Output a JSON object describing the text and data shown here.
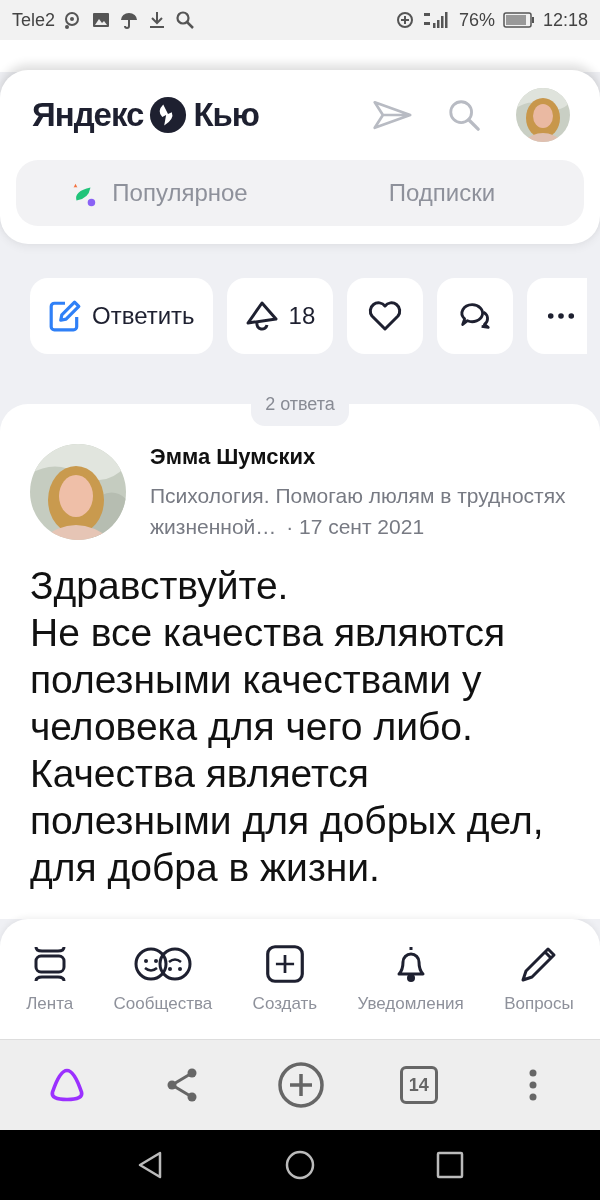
{
  "status_bar": {
    "carrier": "Tele2",
    "battery": "76%",
    "time": "12:18"
  },
  "header": {
    "logo_left": "Яндекс",
    "logo_right": "Кью"
  },
  "tabs": [
    {
      "label": "Популярное",
      "selected": false,
      "kind": "popular"
    },
    {
      "label": "Подписки",
      "selected": false,
      "kind": "plain"
    }
  ],
  "actions": {
    "reply": "Ответить",
    "upvotes": "18"
  },
  "answers_count": "2 ответа",
  "answer": {
    "author": "Эмма Шумских",
    "bio": "Психология. Помогаю люлям в трудностях жизненной…",
    "separator": "·",
    "date": "17 сент 2021",
    "paragraphs": [
      "Здравствуйте.",
      "Не все качества являются полезными качествами у человека для чего либо. Качества является полезными для добрых дел, для добра в жизни."
    ]
  },
  "bottom_nav": [
    {
      "label": "Лента",
      "kind": "feed"
    },
    {
      "label": "Сообщества",
      "kind": "communities"
    },
    {
      "label": "Создать",
      "kind": "create"
    },
    {
      "label": "Уведомления",
      "kind": "notifications"
    },
    {
      "label": "Вопросы",
      "kind": "questions"
    }
  ],
  "browser_bar": {
    "tabs_count": "14"
  }
}
